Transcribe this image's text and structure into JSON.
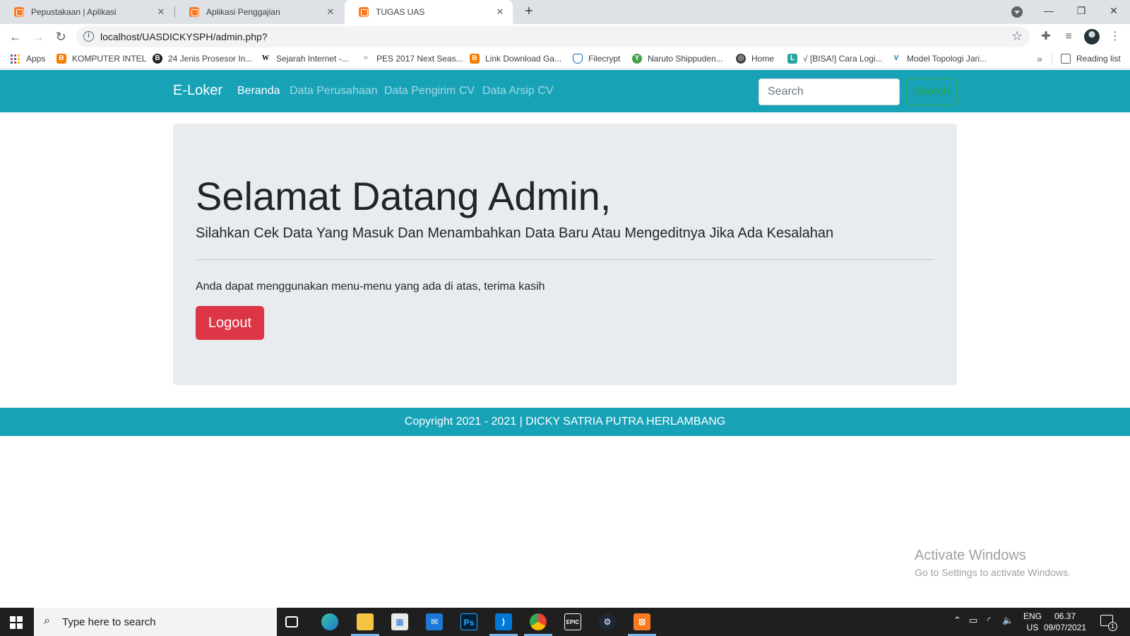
{
  "browser": {
    "tabs": [
      {
        "title": "Pepustakaan | Aplikasi",
        "active": false
      },
      {
        "title": "Aplikasi Penggajian",
        "active": false
      },
      {
        "title": "TUGAS UAS",
        "active": true
      }
    ],
    "new_tab": "+",
    "url": "localhost/UASDICKYSPH/admin.php?",
    "bookmarks": [
      {
        "label": "Apps",
        "icon": "apps-grid-icon"
      },
      {
        "label": "KOMPUTER INTEL",
        "icon": "blogger-icon",
        "color": "#f57c00"
      },
      {
        "label": "24 Jenis Prosesor In...",
        "icon": "b-circle-icon",
        "color": "#212121"
      },
      {
        "label": "Sejarah Internet -...",
        "icon": "wikipedia-icon",
        "color": "#ffffff"
      },
      {
        "label": "PES 2017 Next Seas...",
        "icon": "pes-icon",
        "color": "#9e9e9e"
      },
      {
        "label": "Link Download Ga...",
        "icon": "blogger-icon",
        "color": "#f57c00"
      },
      {
        "label": "Filecrypt",
        "icon": "shield-icon",
        "color": "#1565c0"
      },
      {
        "label": "Naruto Shippuden...",
        "icon": "leaf-icon",
        "color": "#43a047"
      },
      {
        "label": "Home",
        "icon": "globe-icon",
        "color": "#424242"
      },
      {
        "label": "√ [BISA!] Cara Logi...",
        "icon": "site-icon",
        "color": "#26a69a"
      },
      {
        "label": "Model Topologi Jari...",
        "icon": "v-icon",
        "color": "#0277bd"
      }
    ],
    "reading_list": "Reading list"
  },
  "navbar": {
    "brand": "E-Loker",
    "links": [
      {
        "label": "Beranda",
        "active": true
      },
      {
        "label": "Data Perusahaan",
        "active": false
      },
      {
        "label": "Data Pengirim CV",
        "active": false
      },
      {
        "label": "Data Arsip CV",
        "active": false
      }
    ],
    "search_placeholder": "Search",
    "search_button": "Search"
  },
  "jumbotron": {
    "title": "Selamat Datang Admin,",
    "lead": "Silahkan Cek Data Yang Masuk Dan Menambahkan Data Baru Atau Mengeditnya Jika Ada Kesalahan",
    "body": "Anda dapat menggunakan menu-menu yang ada di atas, terima kasih",
    "logout_label": "Logout"
  },
  "footer": {
    "text": "Copyright 2021 - 2021 | DICKY SATRIA PUTRA HERLAMBANG"
  },
  "watermark": {
    "title": "Activate Windows",
    "subtitle": "Go to Settings to activate Windows."
  },
  "taskbar": {
    "search_placeholder": "Type here to search",
    "lang_top": "ENG",
    "lang_bottom": "US",
    "time": "06.37",
    "date": "09/07/2021",
    "notification_count": "1",
    "apps": [
      "task-view-icon",
      "edge-icon",
      "file-explorer-icon",
      "store-icon",
      "mail-icon",
      "photoshop-icon",
      "vscode-icon",
      "chrome-icon",
      "epic-games-icon",
      "steam-icon",
      "xampp-icon"
    ]
  },
  "colors": {
    "navbar": "#17a2b8",
    "logout": "#dc3545",
    "search_button": "#28a745",
    "jumbotron": "#e9ecef"
  }
}
